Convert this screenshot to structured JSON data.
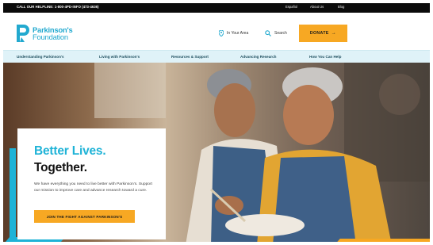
{
  "utility_bar": {
    "helpline": "CALL OUR HELPLINE: 1-800-4PD-INFO (473-4636)",
    "links": [
      "Español",
      "About Us",
      "Blog"
    ]
  },
  "header": {
    "logo_line1": "Parkinson's",
    "logo_line2": "Foundation",
    "location_label": "In Your Area",
    "search_label": "Search",
    "donate_label": "DONATE",
    "donate_arrow": "→"
  },
  "nav": {
    "items": [
      "Understanding Parkinson's",
      "Living with Parkinson's",
      "Resources & Support",
      "Advancing Research",
      "How You Can Help"
    ]
  },
  "hero": {
    "headline_line1": "Better Lives.",
    "headline_line2": "Together.",
    "body": "We have everything you need to live better with Parkinson's. Support our mission to improve care and advance research toward a cure.",
    "cta_label": "JOIN THE FIGHT AGAINST PARKINSON'S"
  },
  "colors": {
    "brand_blue": "#1fb3d7",
    "accent_yellow": "#f7a823",
    "nav_bg": "#dff2f8",
    "utility_bg": "#0b0b0b"
  },
  "icons": [
    "location-pin-icon",
    "search-icon",
    "logo-icon"
  ]
}
